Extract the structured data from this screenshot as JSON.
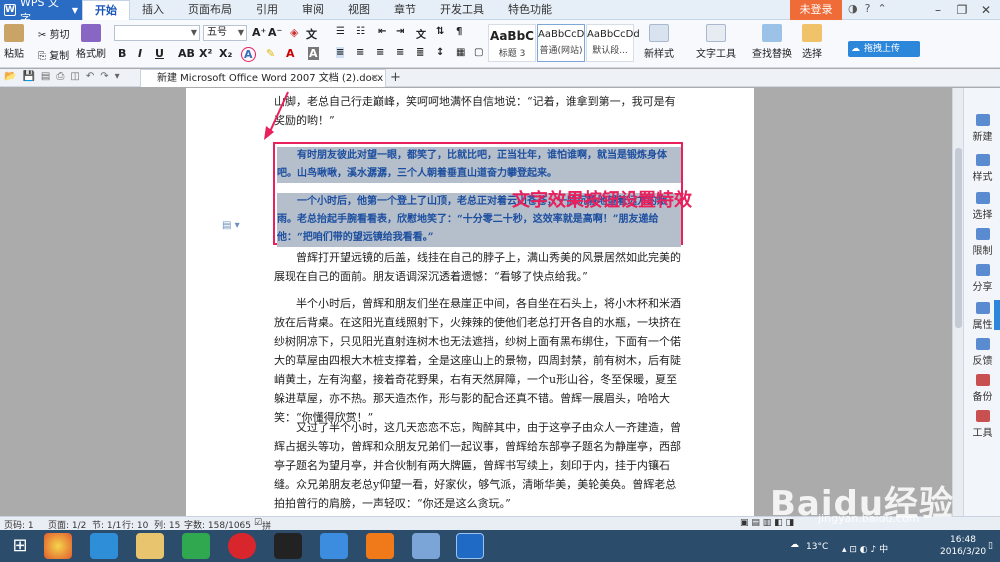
{
  "titlebar": {
    "app_menu": "WPS 文字",
    "tabs": [
      "开始",
      "插入",
      "页面布局",
      "引用",
      "审阅",
      "视图",
      "章节",
      "开发工具",
      "特色功能"
    ],
    "login": "未登录",
    "upload": "拖拽上传"
  },
  "ribbon": {
    "paste": "粘贴",
    "cut": "剪切",
    "copy": "复制",
    "format_painter": "格式刷",
    "font_name": "",
    "font_size": "五号",
    "styles": [
      {
        "sample": "AaBbC",
        "name": "标题 3"
      },
      {
        "sample": "AaBbCcD",
        "name": "普通(网站)"
      },
      {
        "sample": "AaBbCcDd",
        "name": "默认段..."
      }
    ],
    "new_style": "新样式",
    "text_tools": "文字工具",
    "find_replace": "查找替换",
    "select": "选择"
  },
  "doc_tab": {
    "name": "新建 Microsoft Office Word 2007 文档 (2).docx *"
  },
  "document": {
    "para1": "山脚，老总自己行走巅峰，笑呵呵地满怀自信地说：“记着，谁拿到第一，我可是有奖励的哟！”",
    "selected_para1": "有时朋友彼此对望一眼，都笑了，比就比吧，正当壮年，谁怕谁啊，就当是锻炼身体吧。山鸟啾啾，溪水潺潺，三个人朝着垂直山道奋力攀登起来。",
    "selected_para2": "一个小时后，他第一个登上了山顶，老总正对着云山苍苍，一脸沉静地望着远方的烟雨。老总抬起手腕看看表，欣慰地笑了：“十分零二十秒，这效率就是高啊！”朋友递给他：“把咱们带的望远镜给我看看。”",
    "para2": "曾辉打开望远镜的后盖，线挂在自己的脖子上，满山秀美的风景居然如此完美的展现在自己的面前。朋友语调深沉透着遗憾：“看够了快点给我。”",
    "para3": "半个小时后，曾辉和朋友们坐在悬崖正中间，各自坐在石头上，将小木杯和米酒放在后背桌。在这阳光直线照射下，火辣辣的使他们老总打开各自的水瓶，一块挤在纱树阴凉下，只见阳光直射连树木也无法遮挡，纱树上面有黑布绑住，下面有一个偌大的草屋由四根大木桩支撑着，全是这座山上的景物，四周封禁，前有树木，后有陡峭黄土，左有沟壑，接着奇花野果，右有天然屏障，一个u形山谷，冬至保暖，夏至躲进草屋，亦不热。那天造杰作，形与影的配合还真不错。曾辉一展眉头，哈哈大笑：“你懂得欣赏！”",
    "para4": "又过了半个小时，这几天恋恋不忘，陶醉其中，由于这亭子由众人一齐建造，曾辉占据头等功，曾辉和众朋友兄弟们一起议事，曾辉给东部亭子题名为静崖亭，西部亭子题名为望月亭，并合伙制有两大牌匾，曾辉书写续上，刻印于内，挂于内镶石缝。众兄弟朋友老总y仰望一看，好家伙，够气派，清晰华美，美轮美奂。曾辉老总拍拍曾行的肩膀，一声轻叹：“你还是这么贪玩。”",
    "annotation": "文字效果按钮设置特效"
  },
  "sidepanel": [
    "新建",
    "样式",
    "选择",
    "限制",
    "分享",
    "属性",
    "反馈",
    "备份",
    "工具"
  ],
  "statusbar": {
    "page": "页码: 1",
    "pages": "页面: 1/2",
    "section": "节: 1/1",
    "row": "行: 10",
    "col": "列: 15",
    "words": "字数: 158/1065",
    "spell": "拼写检查"
  },
  "taskbar": {
    "temp": "13°C",
    "time": "16:48",
    "date": "2016/3/20"
  },
  "watermark": {
    "logo": "Baidu经验",
    "url": "jingyan.baidu.com"
  }
}
